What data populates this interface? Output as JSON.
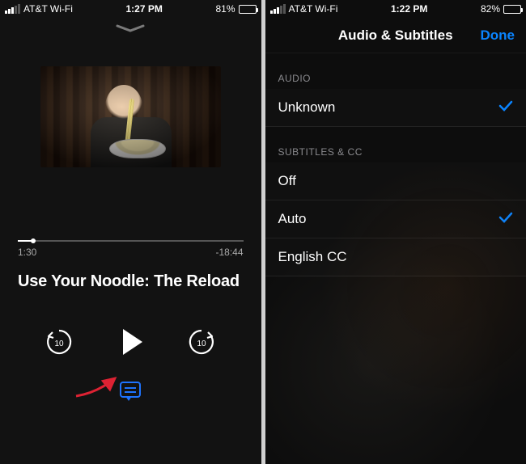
{
  "left": {
    "status": {
      "carrier": "AT&T Wi-Fi",
      "time": "1:27 PM",
      "battery_pct": "81%",
      "battery_fill": 81
    },
    "player": {
      "elapsed": "1:30",
      "remaining": "-18:44",
      "progress_pct": 7,
      "title": "Use Your Noodle: The Reload",
      "skip_seconds": "10"
    }
  },
  "right": {
    "status": {
      "carrier": "AT&T Wi-Fi",
      "time": "1:22 PM",
      "battery_pct": "82%",
      "battery_fill": 82
    },
    "nav": {
      "title": "Audio & Subtitles",
      "done": "Done"
    },
    "sections": {
      "audio": {
        "header": "AUDIO",
        "items": [
          {
            "label": "Unknown",
            "selected": true
          }
        ]
      },
      "subs": {
        "header": "SUBTITLES & CC",
        "items": [
          {
            "label": "Off",
            "selected": false
          },
          {
            "label": "Auto",
            "selected": true
          },
          {
            "label": "English CC",
            "selected": false
          }
        ]
      }
    }
  }
}
